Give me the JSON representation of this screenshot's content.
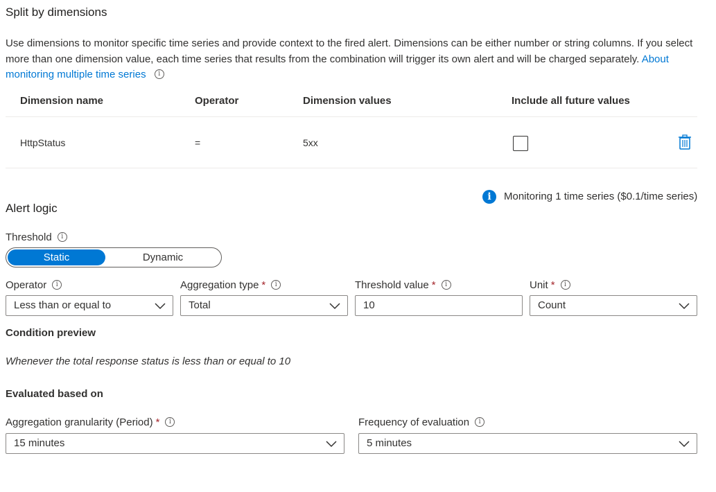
{
  "split": {
    "title": "Split by dimensions",
    "description": "Use dimensions to monitor specific time series and provide context to the fired alert. Dimensions can be either number or string columns. If you select more than one dimension value, each time series that results from the combination will trigger its own alert and will be charged separately.",
    "link": "About monitoring multiple time series",
    "columns": {
      "name": "Dimension name",
      "operator": "Operator",
      "values": "Dimension values",
      "future": "Include all future values"
    },
    "row": {
      "name": "HttpStatus",
      "operator": "=",
      "values": "5xx",
      "include_future": false
    },
    "monitoring_note": "Monitoring 1 time series ($0.1/time series)"
  },
  "alert_logic": {
    "title": "Alert logic",
    "threshold_label": "Threshold",
    "threshold_options": [
      "Static",
      "Dynamic"
    ],
    "threshold_selected": "Static",
    "operator": {
      "label": "Operator",
      "value": "Less than or equal to"
    },
    "aggregation_type": {
      "label": "Aggregation type",
      "value": "Total",
      "required_mark": "*"
    },
    "threshold_value": {
      "label": "Threshold value",
      "value": "10",
      "required_mark": "*"
    },
    "unit": {
      "label": "Unit",
      "value": "Count",
      "required_mark": "*"
    }
  },
  "condition_preview": {
    "title": "Condition preview",
    "text": "Whenever the total response status is less than or equal to 10"
  },
  "evaluated": {
    "title": "Evaluated based on",
    "granularity": {
      "label": "Aggregation granularity (Period)",
      "value": "15 minutes",
      "required_mark": "*"
    },
    "frequency": {
      "label": "Frequency of evaluation",
      "value": "5 minutes"
    }
  },
  "colors": {
    "accent": "#0078d4",
    "required": "#a4262c",
    "text": "#323130",
    "border": "#8a8886"
  }
}
